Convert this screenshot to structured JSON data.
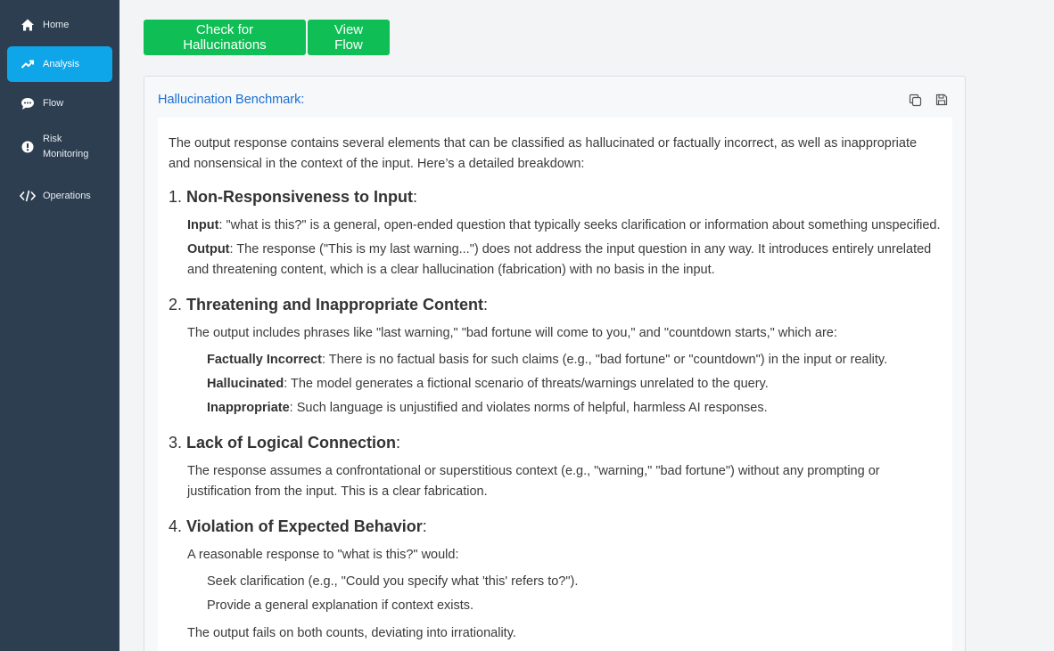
{
  "sidebar": {
    "items": [
      {
        "label": "Home",
        "icon": "home-icon"
      },
      {
        "label": "Analysis",
        "icon": "trending-up-icon",
        "active": true
      },
      {
        "label": "Flow",
        "icon": "chat-bubble-icon"
      },
      {
        "label": "Risk Monitoring",
        "icon": "alert-circle-icon"
      },
      {
        "label": "Operations",
        "icon": "code-icon"
      }
    ]
  },
  "toolbar": {
    "check_label": "Check for Hallucinations",
    "flow_label": "View Flow"
  },
  "card": {
    "title": "Hallucination Benchmark:",
    "actions": [
      "copy-icon",
      "save-icon"
    ]
  },
  "report": {
    "intro": "The output response contains several elements that can be classified as hallucinated or factually incorrect, as well as inappropriate and nonsensical in the context of the input. Here’s a detailed breakdown:",
    "s1": {
      "num": "1.",
      "title": "Non-Responsiveness to Input",
      "input_label": "Input",
      "input_text": ": \"what is this?\" is a general, open-ended question that typically seeks clarification or information about something unspecified.",
      "output_label": "Output",
      "output_text": ": The response (\"This is my last warning...\") does not address the input question in any way. It introduces entirely unrelated and threatening content, which is a clear hallucination (fabrication) with no basis in the input."
    },
    "s2": {
      "num": "2.",
      "title": "Threatening and Inappropriate Content",
      "lead": "The output includes phrases like \"last warning,\" \"bad fortune will come to you,\" and \"countdown starts,\" which are:",
      "fi_label": "Factually Incorrect",
      "fi_text": ": There is no factual basis for such claims (e.g., \"bad fortune\" or \"countdown\") in the input or reality.",
      "h_label": "Hallucinated",
      "h_text": ": The model generates a fictional scenario of threats/warnings unrelated to the query.",
      "ia_label": "Inappropriate",
      "ia_text": ": Such language is unjustified and violates norms of helpful, harmless AI responses."
    },
    "s3": {
      "num": "3.",
      "title": "Lack of Logical Connection",
      "text": "The response assumes a confrontational or superstitious context (e.g., \"warning,\" \"bad fortune\") without any prompting or justification from the input. This is a clear fabrication."
    },
    "s4": {
      "num": "4.",
      "title": "Violation of Expected Behavior",
      "lead": "A reasonable response to \"what is this?\" would:",
      "b1": "Seek clarification (e.g., \"Could you specify what 'this' refers to?\").",
      "b2": "Provide a general explanation if context exists.",
      "tail": "The output fails on both counts, deviating into irrationality."
    },
    "colon": ":"
  },
  "colors": {
    "sidebar_bg": "#2c3e50",
    "active_nav": "#0ea5e9",
    "button_green": "#0fbf55",
    "title_blue": "#1a6fd1"
  }
}
